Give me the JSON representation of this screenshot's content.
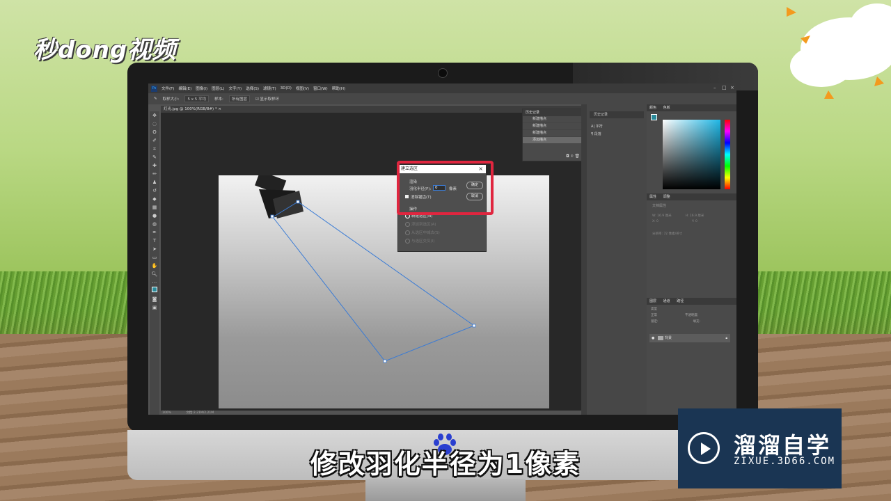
{
  "brand_left": "秒dong视频",
  "subtitle": "修改羽化半径为1像素",
  "watermark": {
    "name": "溜溜自学",
    "site": "ZIXUE.3D66.COM"
  },
  "ps": {
    "menu": [
      "文件(F)",
      "编辑(E)",
      "图像(I)",
      "图层(L)",
      "文字(Y)",
      "选择(S)",
      "滤镜(T)",
      "3D(D)",
      "视图(V)",
      "窗口(W)",
      "帮助(H)"
    ],
    "options": {
      "sample_label": "取样大小:",
      "sample_value": "5 x 5 平均",
      "sample2_label": "样本:",
      "sample2_value": "所有图层",
      "ring_label": "显示取样环"
    },
    "doc_tab": "灯光.jpg @ 100%(RGB/8#) *",
    "status": {
      "zoom": "100%",
      "doc": "文档:2.21M/2.21M"
    },
    "history": {
      "title": "历史记录",
      "items": [
        "新建描点",
        "新建描点",
        "新建描点",
        "添加描点"
      ]
    },
    "mid_panel": {
      "items": [
        "历史记录",
        "字符",
        "段落"
      ]
    },
    "color_tabs": [
      "颜色",
      "色板"
    ],
    "props": {
      "tabs": [
        "属性",
        "调整"
      ],
      "label": "文档属性",
      "w": "W: 16.9 厘米",
      "h": "H: 16.9 厘米",
      "x": "X: 0",
      "y": "Y: 0",
      "res": "分辨率: 72 像素/英寸"
    },
    "layers": {
      "tabs": [
        "图层",
        "通道",
        "路径"
      ],
      "kind": "类型",
      "mode": "正常",
      "opacity": "不透明度:",
      "lock": "锁定:",
      "fill": "填充:",
      "layer": "背景"
    },
    "dialog": {
      "title": "建立选区",
      "render_group": "渲染",
      "feather_label": "羽化半径(F):",
      "feather_value": "0",
      "feather_unit": "像素",
      "antialias": "消除锯齿(T)",
      "ok": "确定",
      "cancel": "取消",
      "op_group": "操作",
      "ops": [
        "新建选区(N)",
        "添加到选区(A)",
        "从选区中减去(S)",
        "与选区交叉(I)"
      ]
    }
  },
  "colors": {
    "highlight": "#e0263f",
    "accent": "#31a8ff"
  }
}
